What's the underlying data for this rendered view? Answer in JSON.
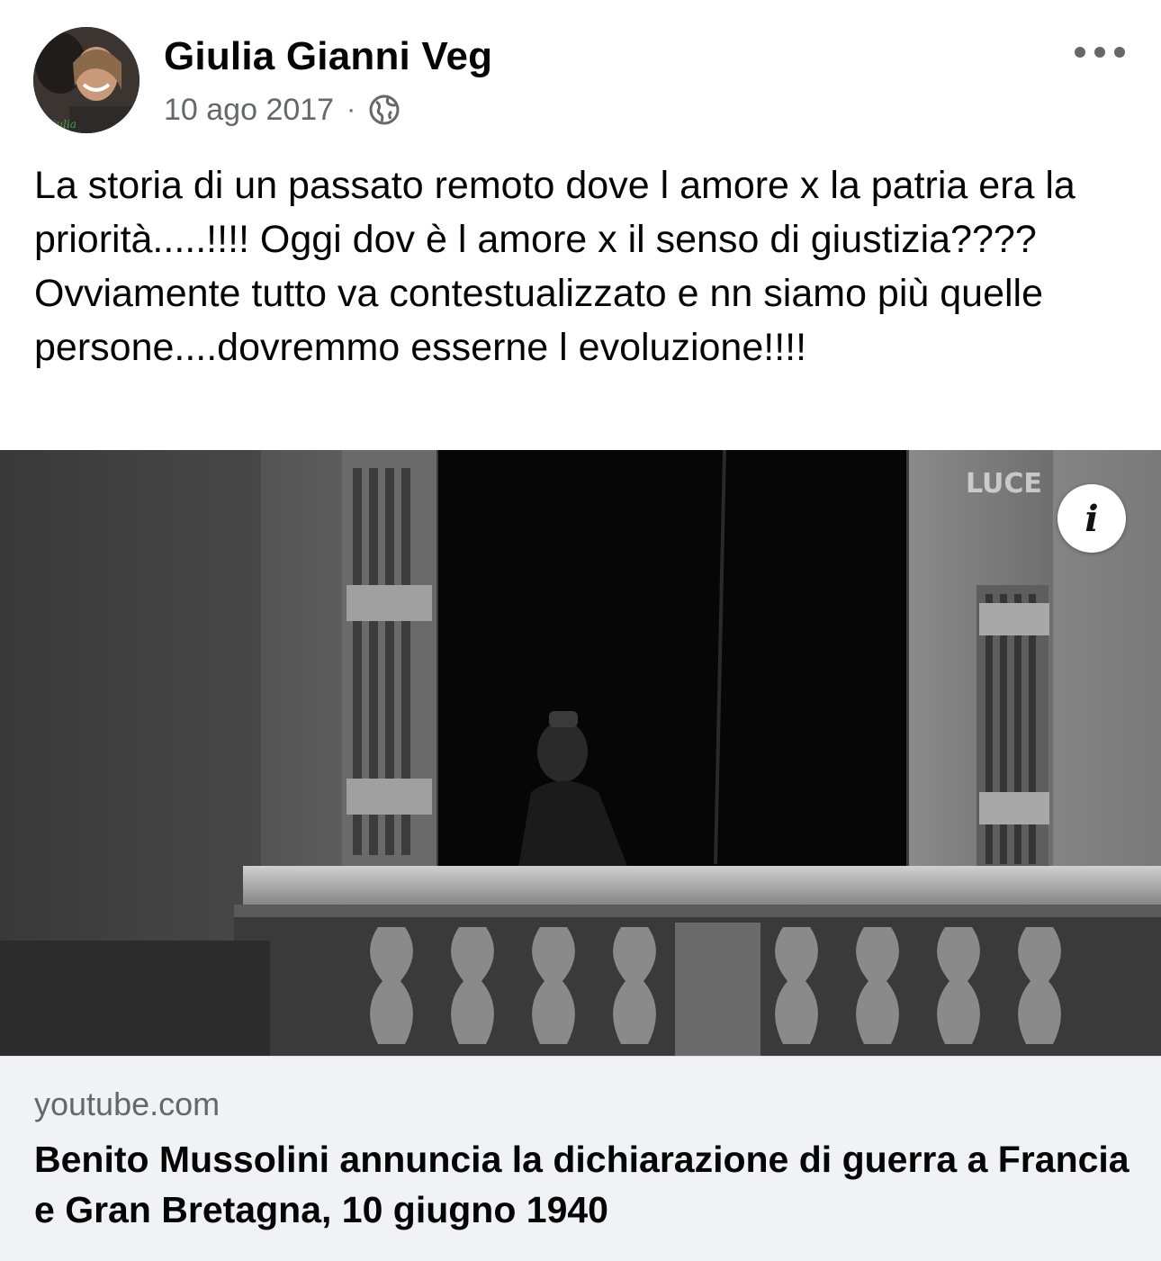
{
  "post": {
    "author": "Giulia Gianni Veg",
    "date": "10 ago 2017",
    "separator": "·",
    "audience_icon": "globe-icon",
    "more_icon": "more-options-icon",
    "text": "La storia di un passato remoto dove l amore x la patria era la priorità.....!!!! Oggi dov è l amore x il senso di giustizia????\nOvviamente tutto va contestualizzato e nn siamo più quelle persone....dovremmo esserne l evoluzione!!!!"
  },
  "link_preview": {
    "watermark": "LUCE",
    "info_icon": "info-icon",
    "info_label": "i",
    "domain": "youtube.com",
    "title": "Benito Mussolini annuncia la dichiarazione di guerra a Francia e Gran Bretagna, 10 giugno 1940"
  },
  "colors": {
    "text_primary": "#050505",
    "text_secondary": "#65676b",
    "link_footer_bg": "#f0f2f5"
  }
}
